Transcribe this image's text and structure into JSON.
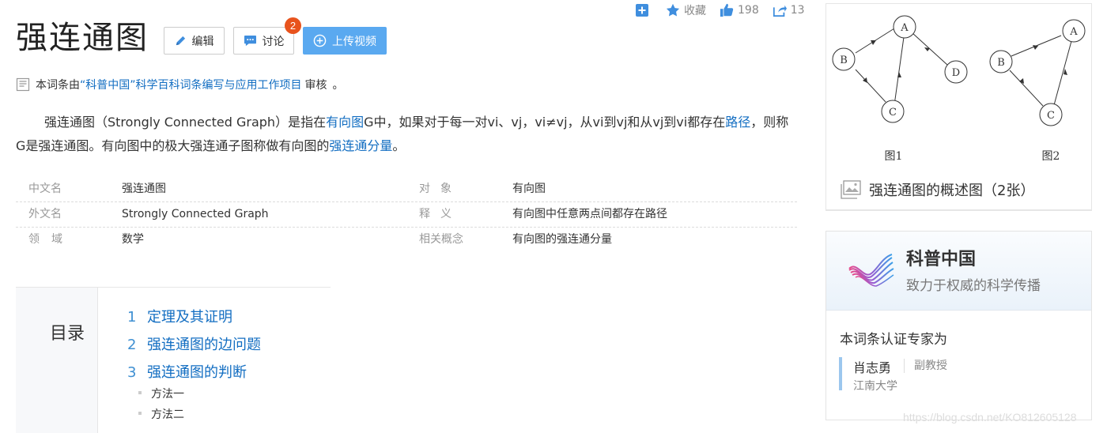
{
  "top_stats": {
    "favorite_label": "收藏",
    "like_count": "198",
    "share_count": "13"
  },
  "title": "强连通图",
  "buttons": {
    "edit": "编辑",
    "discuss": "讨论",
    "discuss_badge": "2",
    "upload": "上传视频"
  },
  "edit_line": {
    "prefix": "本词条由",
    "link": "“科普中国”科学百科词条编写与应用工作项目",
    "suffix": "审核",
    "mark": "。"
  },
  "intro": {
    "p1": "强连通图（Strongly Connected Graph）是指在",
    "l1": "有向图",
    "p2": "G中，如果对于每一对vi、vj，vi≠vj，从vi到vj和从vj到vi都存在",
    "l2": "路径",
    "p3": "，则称G是强连通图。有向图中的极大强连通子图称做有向图的",
    "l3": "强连通分量",
    "p4": "。"
  },
  "infobox": [
    {
      "k1": "中文名",
      "v1": "强连通图",
      "k2": "对象",
      "v2": "有向图"
    },
    {
      "k1": "外文名",
      "v1": "Strongly Connected Graph",
      "k2": "释义",
      "v2": "有向图中任意两点间都存在路径"
    },
    {
      "k1": "领域",
      "v1": "数学",
      "k2": "相关概念",
      "v2": "有向图的强连通分量"
    }
  ],
  "catalog": {
    "title": "目录",
    "items": [
      {
        "num": "1",
        "label": "定理及其证明"
      },
      {
        "num": "2",
        "label": "强连通图的边问题"
      },
      {
        "num": "3",
        "label": "强连通图的判断"
      }
    ],
    "subitems": [
      "方法一",
      "方法二"
    ]
  },
  "image_card": {
    "fig1": {
      "nodes": [
        "A",
        "B",
        "C",
        "D"
      ],
      "caption": "图1"
    },
    "fig2": {
      "nodes": [
        "A",
        "B",
        "C"
      ],
      "caption": "图2"
    },
    "caption": "强连通图的概述图（2张）"
  },
  "science_card": {
    "brand": "科普中国",
    "slogan": "致力于权威的科学传播",
    "cert_label": "本词条认证专家为",
    "expert_name": "肖志勇",
    "expert_title": "副教授",
    "expert_org": "江南大学"
  },
  "watermark": "https://blog.csdn.net/KO812605128"
}
